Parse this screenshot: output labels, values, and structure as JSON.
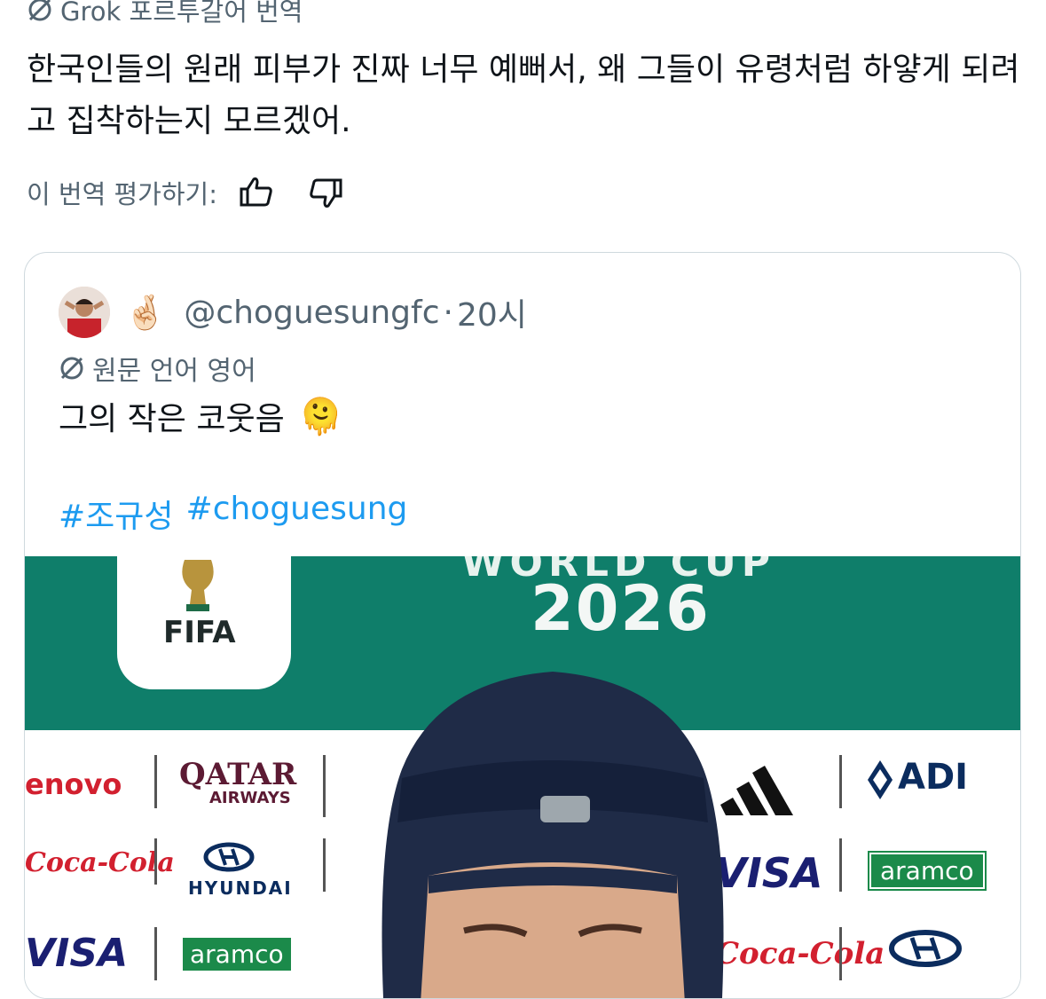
{
  "translation": {
    "header": "Grok 포르투갈어 번역",
    "body": "한국인들의 원래 피부가 진짜 너무 예뻐서, 왜 그들이 유령처럼 하얗게 되려고 집착하는지 모르겠어.",
    "rate_label": "이 번역 평가하기:",
    "thumbs_up_icon": "thumbs-up-icon",
    "thumbs_down_icon": "thumbs-down-icon"
  },
  "quote": {
    "handle": "@choguesungfc",
    "separator": "·",
    "time": "20시",
    "emoji_after_name": "🤞🏻",
    "original_language": "원문 언어 영어",
    "text": "그의 작은 코웃음",
    "text_emoji": "🫠",
    "hashtags": [
      "#조규성",
      "#choguesung"
    ]
  },
  "media": {
    "banner_top": "WORLD CUP",
    "year": "2026",
    "fifa": "FIFA",
    "sponsors": [
      "enovo",
      "QATAR",
      "AIRWAYS",
      "Coca-Cola",
      "HYUNDAI",
      "VISA",
      "aramco",
      "ADI",
      "VISA",
      "aramco",
      "Coca-Cola"
    ],
    "colors": {
      "band": "#0f7e6a",
      "aramco": "#1b8a4a",
      "visa": "#1a1f71",
      "coke": "#d2202f"
    }
  }
}
